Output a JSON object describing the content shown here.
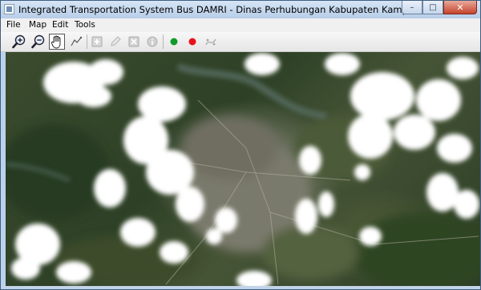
{
  "window": {
    "title": "Integrated Transportation System Bus DAMRI - Dinas Perhubungan Kabupaten Kampar",
    "controls": {
      "minimize": "–",
      "maximize": "□",
      "close": "✕"
    }
  },
  "menu": [
    "File",
    "Map",
    "Edit",
    "Tools"
  ],
  "toolbar": {
    "buttons": [
      {
        "icon": "zoom-in-icon",
        "active": false,
        "enabled": true
      },
      {
        "icon": "zoom-out-icon",
        "active": false,
        "enabled": true
      },
      {
        "icon": "pan-hand-icon",
        "active": true,
        "enabled": true
      },
      {
        "icon": "polyline-icon",
        "active": false,
        "enabled": true
      },
      {
        "icon": "add-icon",
        "active": false,
        "enabled": false
      },
      {
        "icon": "edit-pencil-icon",
        "active": false,
        "enabled": false
      },
      {
        "icon": "delete-icon",
        "active": false,
        "enabled": false
      },
      {
        "icon": "info-icon",
        "active": false,
        "enabled": false
      },
      {
        "icon": "green-dot-icon",
        "active": false,
        "enabled": true
      },
      {
        "icon": "red-dot-icon",
        "active": false,
        "enabled": true
      },
      {
        "icon": "route-icon",
        "active": false,
        "enabled": false
      }
    ]
  },
  "colors": {
    "titlebar": "#c4d7ee",
    "close_button": "#c7432c",
    "green_marker": "#119a2a",
    "red_marker": "#e8121b",
    "vegetation": "#2e4126",
    "urban": "#8a8a7e",
    "cloud": "#ffffff"
  }
}
